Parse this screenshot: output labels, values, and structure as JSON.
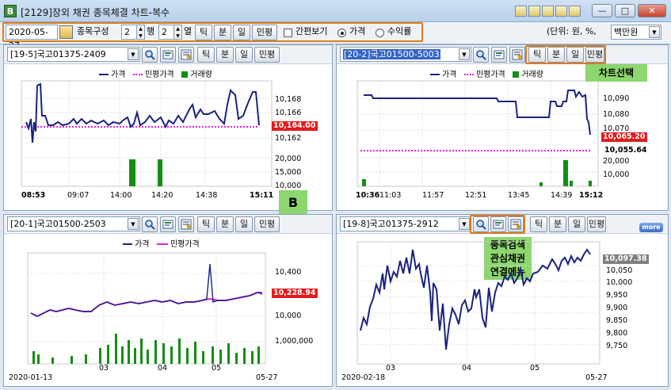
{
  "window": {
    "title": "[2129]장외 채권 종목체결 차트-복수",
    "app_icon_letter": "B",
    "minimize": "—",
    "maximize": "□",
    "close": "✕"
  },
  "toolbar": {
    "date": "2020-05-27",
    "composition_label": "종목구성",
    "rows_value": "2",
    "rows_label": "행",
    "cols_value": "2",
    "cols_label": "열",
    "period_buttons": [
      "틱",
      "분",
      "일",
      "민평"
    ],
    "simple_view_label": "간편보기",
    "radio_price": "가격",
    "radio_yield": "수익률",
    "unit_label": "(단위: 원, %,",
    "unit_value": "백만원"
  },
  "callouts": {
    "b_badge": "B",
    "chart_select": "차트선택",
    "menu_note_1": "종목검색",
    "menu_note_2": "관심채권",
    "menu_note_3": "연결메뉴",
    "more": "more"
  },
  "panels": [
    {
      "code": "[19-5]국고01375-2409",
      "legend": [
        "가격",
        "민평가격",
        "거래량"
      ],
      "y_labels": [
        "10,168",
        "10,166",
        "10,162",
        "20,000",
        "15,000",
        "10,000"
      ],
      "price_tag": "10,164.00",
      "x_labels": [
        "08:53",
        "09:07",
        "14:00",
        "14:20",
        "14:38",
        "15:11"
      ]
    },
    {
      "code": "[20-2]국고01500-5003",
      "legend": [
        "가격",
        "민평가격",
        "거래량"
      ],
      "y_labels": [
        "10,090",
        "10,080",
        "10,070",
        "20,000",
        "10,000"
      ],
      "price_tag": "10,065.20",
      "minpyung_tag": "10,055.64",
      "x_labels": [
        "10:36",
        "11:03",
        "11:57",
        "12:51",
        "13:45",
        "14:39",
        "15:12"
      ]
    },
    {
      "code": "[20-1]국고01500-2503",
      "legend": [
        "가격",
        "민평가격"
      ],
      "y_labels": [
        "10,400",
        "10,000",
        "1,000,000"
      ],
      "price_tag": "10,228.94",
      "x_labels": [
        "2020-01-13",
        "03",
        "04",
        "05",
        "05-27"
      ]
    },
    {
      "code": "[19-8]국고01375-2912",
      "legend": [],
      "y_labels": [
        "10,050",
        "10,000",
        "9,950",
        "9,900",
        "9,850",
        "9,800",
        "9,750"
      ],
      "price_tag": "10,097.38",
      "x_labels": [
        "2020-02-18",
        "03",
        "04",
        "05",
        "05-27"
      ]
    }
  ],
  "colors": {
    "price_line": "#1a237e",
    "minpyung": "#e020e0",
    "volume": "#138f13",
    "price_tag_red": "#e01c1c",
    "price_tag_gray": "#808080",
    "highlight": "#e07b1a",
    "callout_green": "#8ed66f"
  },
  "icons": {
    "search": "magnifier-icon",
    "interest": "interest-bond-icon",
    "link": "link-menu-icon",
    "calendar": "calendar-icon"
  },
  "chart_data": [
    {
      "type": "line",
      "title": "[19-5]국고01375-2409",
      "x": [
        "08:53",
        "09:07",
        "14:00",
        "14:20",
        "14:38",
        "15:11"
      ],
      "series": [
        {
          "name": "가격",
          "values": [
            10168.4,
            10166.0,
            10160.5,
            10165.5,
            10166.5,
            10164.0
          ]
        },
        {
          "name": "민평가격",
          "values": [
            10164.0,
            10164.0,
            10164.0,
            10164.0,
            10164.0,
            10164.0
          ]
        },
        {
          "name": "거래량",
          "values": [
            0,
            0,
            20000,
            20000,
            0,
            0
          ]
        }
      ]
    },
    {
      "type": "line",
      "title": "[20-2]국고01500-5003",
      "x": [
        "10:36",
        "11:03",
        "11:57",
        "12:51",
        "13:45",
        "14:39",
        "15:12"
      ],
      "series": [
        {
          "name": "가격",
          "values": [
            10092,
            10091,
            10091,
            10091,
            10085,
            10093,
            10065.2
          ]
        },
        {
          "name": "민평가격",
          "values": [
            10055.64,
            10055.64,
            10055.64,
            10055.64,
            10055.64,
            10055.64,
            10055.64
          ]
        },
        {
          "name": "거래량",
          "values": [
            2000,
            0,
            0,
            0,
            0,
            20000,
            2000
          ]
        }
      ]
    },
    {
      "type": "line",
      "title": "[20-1]국고01500-2503",
      "x": [
        "2020-01-13",
        "03",
        "04",
        "05",
        "05-27"
      ],
      "series": [
        {
          "name": "가격",
          "values": [
            10020,
            10150,
            10170,
            10200,
            10228.94
          ]
        },
        {
          "name": "민평가격",
          "values": [
            10020,
            10150,
            10170,
            10200,
            10228.94
          ]
        }
      ]
    },
    {
      "type": "line",
      "title": "[19-8]국고01375-2912",
      "x": [
        "2020-02-18",
        "03",
        "04",
        "05",
        "05-27"
      ],
      "series": [
        {
          "name": "가격",
          "values": [
            9800,
            9900,
            9760,
            10000,
            10097.38
          ]
        }
      ]
    }
  ]
}
